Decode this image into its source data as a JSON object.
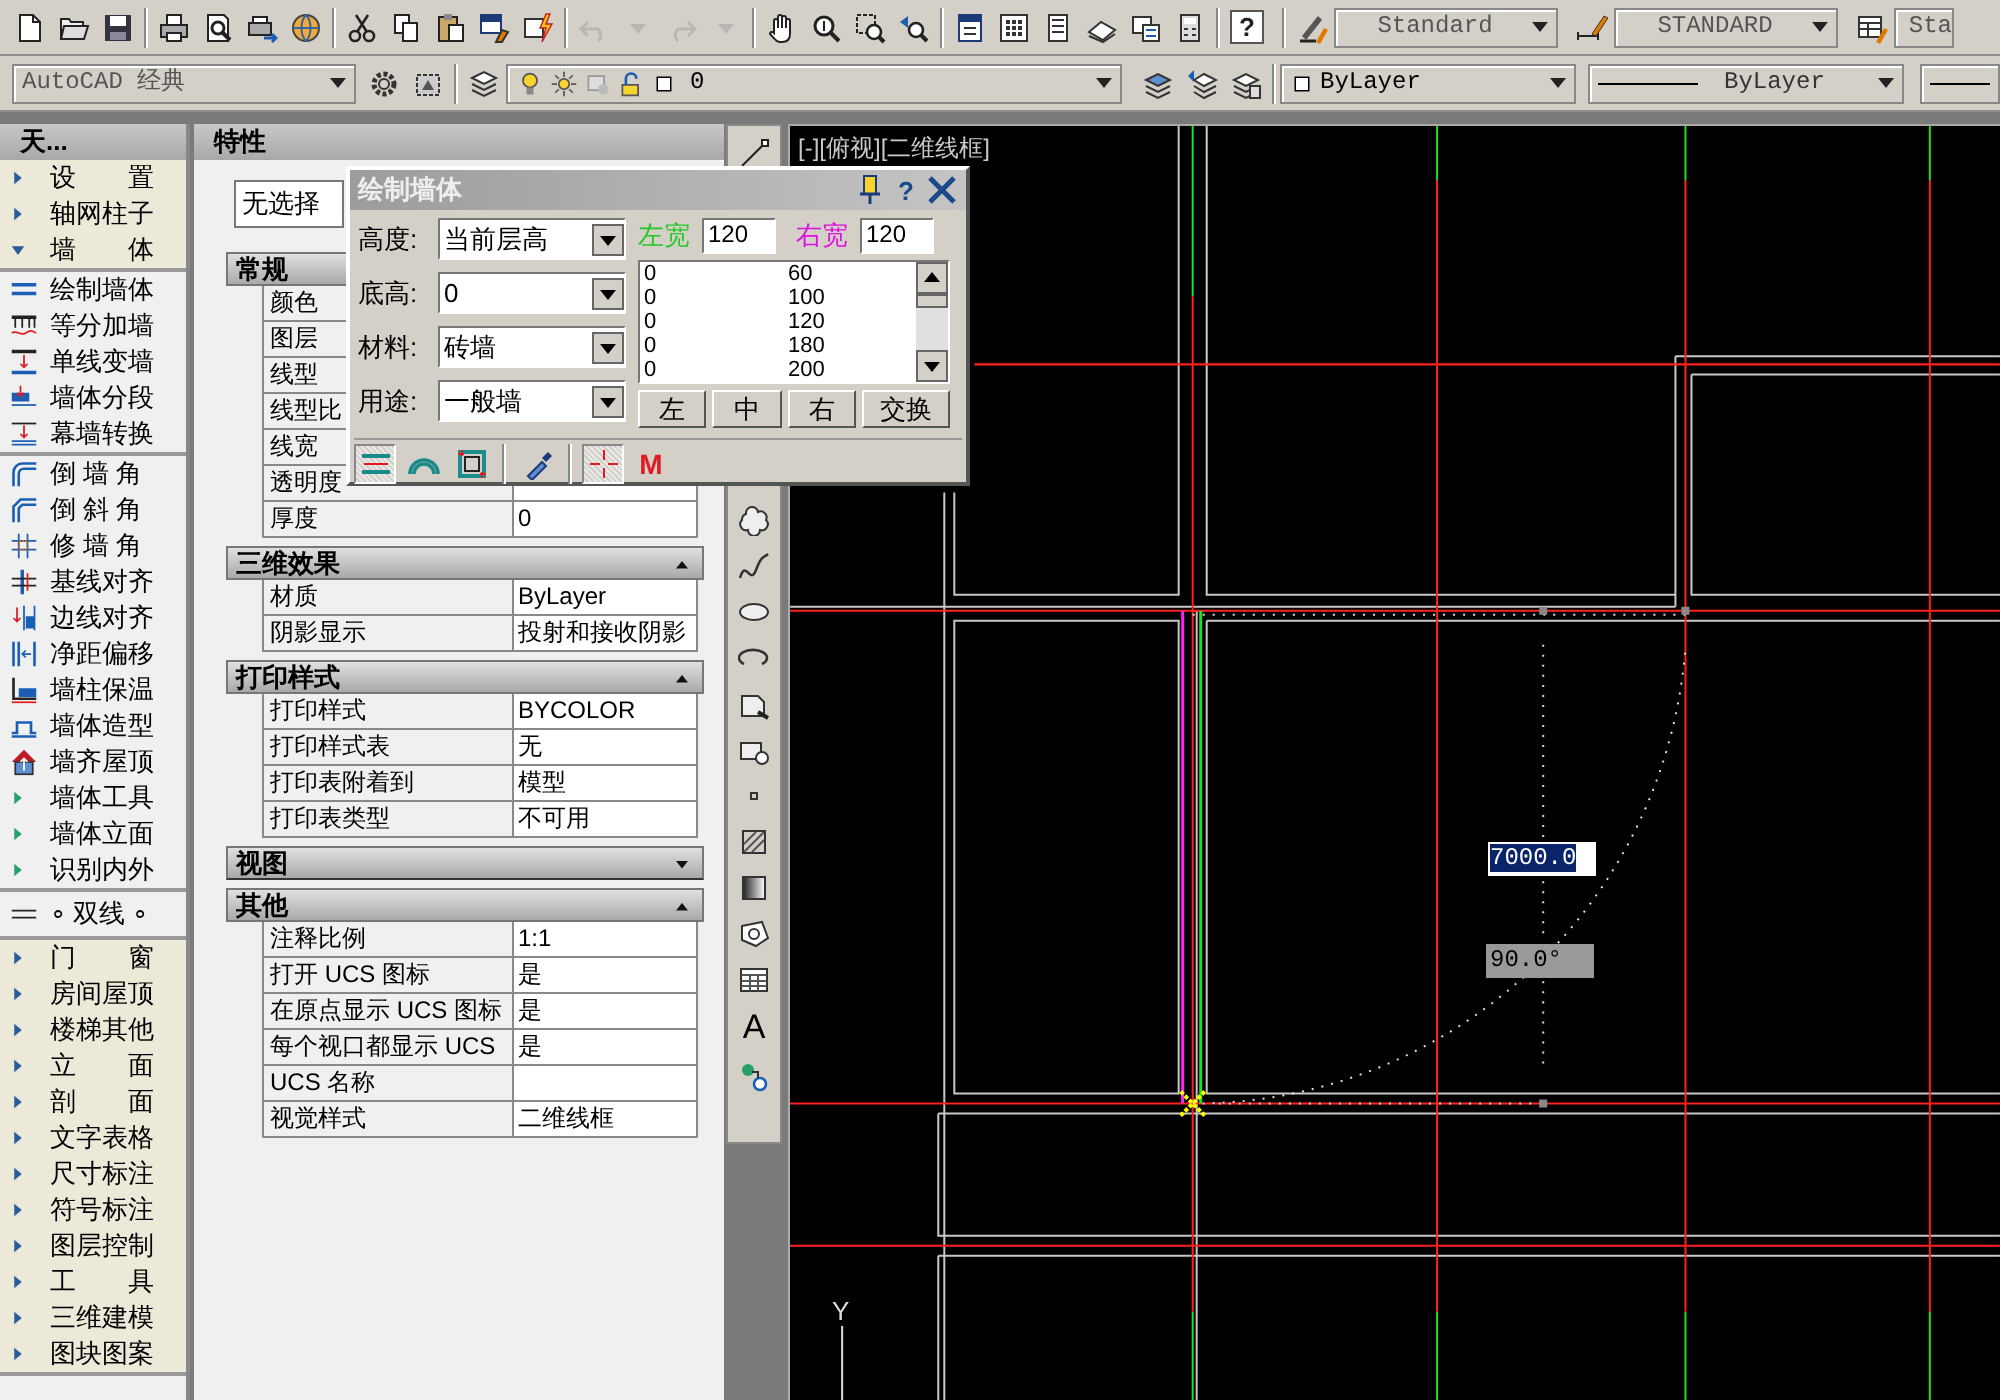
{
  "toolbar": {
    "button_groups": [
      [
        {
          "kind": "new",
          "disabled": false
        },
        {
          "kind": "open",
          "disabled": false
        },
        {
          "kind": "save",
          "disabled": false
        }
      ],
      [
        {
          "kind": "plot",
          "disabled": false
        },
        {
          "kind": "preview",
          "disabled": false
        },
        {
          "kind": "publish",
          "disabled": false
        },
        {
          "kind": "print3d",
          "disabled": false
        }
      ],
      [
        {
          "kind": "cut",
          "disabled": false
        },
        {
          "kind": "copy",
          "disabled": false
        },
        {
          "kind": "paste",
          "disabled": false
        },
        {
          "kind": "match",
          "disabled": false
        },
        {
          "kind": "blockedit",
          "disabled": false
        }
      ],
      [
        {
          "kind": "undo",
          "disabled": true
        },
        {
          "kind": "menu",
          "disabled": true
        },
        {
          "kind": "redo",
          "disabled": true
        },
        {
          "kind": "menu",
          "disabled": true
        }
      ],
      [
        {
          "kind": "pan",
          "disabled": false
        },
        {
          "kind": "zoomrt",
          "disabled": false
        },
        {
          "kind": "zoomwin",
          "disabled": false
        },
        {
          "kind": "zoomprev",
          "disabled": false
        }
      ],
      [
        {
          "kind": "props",
          "disabled": false
        },
        {
          "kind": "design",
          "disabled": false
        },
        {
          "kind": "palette",
          "disabled": false
        },
        {
          "kind": "sheet",
          "disabled": false
        },
        {
          "kind": "markup",
          "disabled": false
        },
        {
          "kind": "calc",
          "disabled": false
        }
      ],
      [
        {
          "kind": "help",
          "label": "?",
          "disabled": false
        }
      ]
    ],
    "styles": [
      {
        "kind": "text",
        "value": "Standard"
      },
      {
        "kind": "dim",
        "value": "STANDARD"
      },
      {
        "kind": "table",
        "value": "Sta"
      }
    ]
  },
  "layers_toolbar": {
    "workspace": "AutoCAD 经典",
    "layer": "0",
    "color_setting": "ByLayer",
    "linetype": "ByLayer"
  },
  "sidebar": {
    "title": "天...",
    "groups": [
      {
        "items": [
          {
            "kind": "category",
            "label": "设　　置",
            "expanded": false
          },
          {
            "kind": "category",
            "label": "轴网柱子",
            "expanded": false
          },
          {
            "kind": "category",
            "label": "墙　　体",
            "expanded": true
          }
        ]
      },
      {
        "items": [
          {
            "kind": "command",
            "label": "绘制墙体"
          },
          {
            "kind": "command",
            "label": "等分加墙"
          },
          {
            "kind": "command",
            "label": "单线变墙"
          },
          {
            "kind": "command",
            "label": "墙体分段"
          },
          {
            "kind": "command",
            "label": "幕墙转换"
          }
        ]
      },
      {
        "items": [
          {
            "kind": "command",
            "label": "倒 墙 角"
          },
          {
            "kind": "command",
            "label": "倒 斜 角"
          },
          {
            "kind": "command",
            "label": "修 墙 角"
          },
          {
            "kind": "command",
            "label": "基线对齐"
          },
          {
            "kind": "command",
            "label": "边线对齐"
          },
          {
            "kind": "command",
            "label": "净距偏移"
          },
          {
            "kind": "command",
            "label": "墙柱保温"
          },
          {
            "kind": "command",
            "label": "墙体造型"
          },
          {
            "kind": "command",
            "label": "墙齐屋顶"
          },
          {
            "kind": "submenu",
            "label": "墙体工具"
          },
          {
            "kind": "submenu",
            "label": "墙体立面"
          },
          {
            "kind": "submenu",
            "label": "识别内外"
          }
        ]
      },
      {
        "items": [
          {
            "kind": "toggle",
            "label": "∘ 双线 ∘"
          }
        ]
      },
      {
        "items": [
          {
            "kind": "category",
            "label": "门　　窗",
            "expanded": false
          },
          {
            "kind": "category",
            "label": "房间屋顶",
            "expanded": false
          },
          {
            "kind": "category",
            "label": "楼梯其他",
            "expanded": false
          },
          {
            "kind": "category",
            "label": "立　　面",
            "expanded": false
          },
          {
            "kind": "category",
            "label": "剖　　面",
            "expanded": false
          },
          {
            "kind": "category",
            "label": "文字表格",
            "expanded": false
          },
          {
            "kind": "category",
            "label": "尺寸标注",
            "expanded": false
          },
          {
            "kind": "category",
            "label": "符号标注",
            "expanded": false
          },
          {
            "kind": "category",
            "label": "图层控制",
            "expanded": false
          },
          {
            "kind": "category",
            "label": "工　　具",
            "expanded": false
          },
          {
            "kind": "category",
            "label": "三维建模",
            "expanded": false
          },
          {
            "kind": "category",
            "label": "图块图案",
            "expanded": false
          }
        ]
      }
    ]
  },
  "properties": {
    "title": "特性",
    "selection": "无选择",
    "sections": [
      {
        "title": "常规",
        "expanded": true,
        "rows": [
          {
            "label": "颜色"
          },
          {
            "label": "图层"
          },
          {
            "label": "线型"
          },
          {
            "label": "线型比"
          },
          {
            "label": "线宽"
          },
          {
            "label": "透明度"
          },
          {
            "label": "厚度",
            "value": "0"
          }
        ]
      },
      {
        "title": "三维效果",
        "expanded": true,
        "rows": [
          {
            "label": "材质",
            "value": "ByLayer"
          },
          {
            "label": "阴影显示",
            "value": "投射和接收阴影"
          }
        ]
      },
      {
        "title": "打印样式",
        "expanded": true,
        "rows": [
          {
            "label": "打印样式",
            "value": "BYCOLOR"
          },
          {
            "label": "打印样式表",
            "value": "无"
          },
          {
            "label": "打印表附着到",
            "value": "模型"
          },
          {
            "label": "打印表类型",
            "value": "不可用"
          }
        ]
      },
      {
        "title": "视图",
        "expanded": false
      },
      {
        "title": "其他",
        "expanded": true,
        "rows": [
          {
            "label": "注释比例",
            "value": "1:1"
          },
          {
            "label": "打开 UCS 图标",
            "value": "是"
          },
          {
            "label": "在原点显示 UCS 图标",
            "value": "是"
          },
          {
            "label": "每个视口都显示 UCS",
            "value": "是"
          },
          {
            "label": "UCS 名称"
          },
          {
            "label": "视觉样式",
            "value": "二维线框"
          }
        ]
      }
    ]
  },
  "draw_toolbar": [
    {
      "kind": "line"
    },
    {
      "kind": "cloud"
    },
    {
      "kind": "spline"
    },
    {
      "kind": "ellipse"
    },
    {
      "kind": "ellipse-arc"
    },
    {
      "kind": "insert"
    },
    {
      "kind": "block"
    },
    {
      "kind": "point"
    },
    {
      "kind": "hatch"
    },
    {
      "kind": "gradient"
    },
    {
      "kind": "region"
    },
    {
      "kind": "table"
    },
    {
      "kind": "text",
      "label": "A"
    },
    {
      "kind": "add"
    }
  ],
  "dialog": {
    "title": "绘制墙体",
    "help_label": "?",
    "fields": [
      {
        "label": "高度:",
        "value": "当前层高"
      },
      {
        "label": "底高:",
        "value": "0"
      },
      {
        "label": "材料:",
        "value": "砖墙"
      },
      {
        "label": "用途:",
        "value": "一般墙"
      }
    ],
    "left_width": {
      "label": "左宽",
      "value": "120"
    },
    "right_width": {
      "label": "右宽",
      "value": "120"
    },
    "width_list": [
      {
        "col_1": "0",
        "col_2": "60"
      },
      {
        "col_1": "0",
        "col_2": "100"
      },
      {
        "col_1": "0",
        "col_2": "120"
      },
      {
        "col_1": "0",
        "col_2": "180"
      },
      {
        "col_1": "0",
        "col_2": "200"
      }
    ],
    "buttons": [
      "左",
      "中",
      "右",
      "交换"
    ],
    "tools": [
      {
        "kind": "straight",
        "pressed": true
      },
      {
        "kind": "arc",
        "pressed": false
      },
      {
        "kind": "rect",
        "pressed": false
      },
      {
        "kind": "pick",
        "pressed": false
      },
      {
        "kind": "snap",
        "pressed": true
      },
      {
        "kind": "mode",
        "label": "M",
        "pressed": false
      }
    ]
  },
  "canvas": {
    "viewport_label": "[-][俯视][二维线框]",
    "length_input": "7000.0",
    "angle_input": "90.0°",
    "ucs_label": "Y"
  }
}
